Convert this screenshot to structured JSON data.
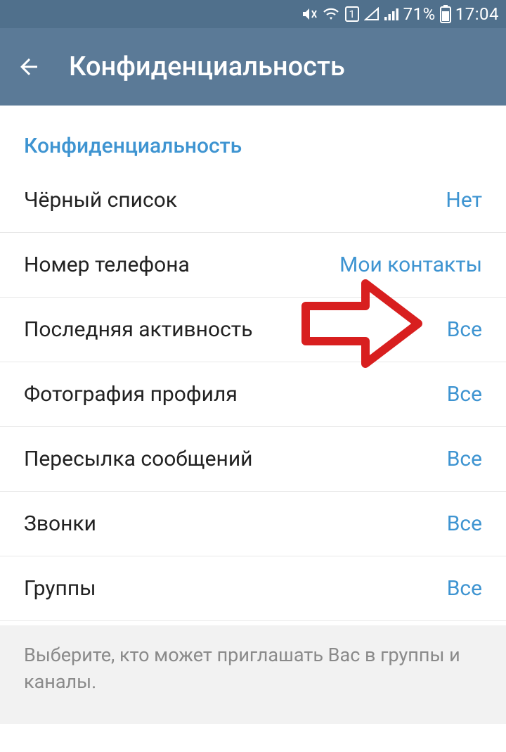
{
  "statusBar": {
    "battery": "71%",
    "time": "17:04",
    "simLabel": "1"
  },
  "appBar": {
    "title": "Конфиденциальность"
  },
  "section": {
    "header": "Конфиденциальность",
    "items": [
      {
        "label": "Чёрный список",
        "value": "Нет"
      },
      {
        "label": "Номер телефона",
        "value": "Мои контакты"
      },
      {
        "label": "Последняя активность",
        "value": "Все"
      },
      {
        "label": "Фотография профиля",
        "value": "Все"
      },
      {
        "label": "Пересылка сообщений",
        "value": "Все"
      },
      {
        "label": "Звонки",
        "value": "Все"
      },
      {
        "label": "Группы",
        "value": "Все"
      }
    ]
  },
  "footerNote": "Выберите, кто может приглашать Вас в группы и каналы."
}
